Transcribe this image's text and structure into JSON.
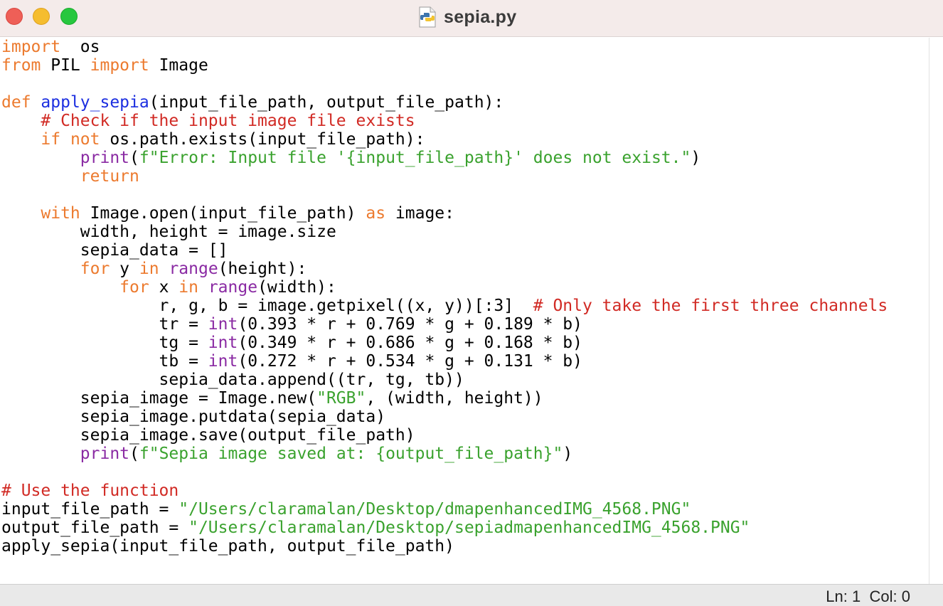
{
  "window": {
    "title": "sepia.py",
    "file_icon": "python-file-icon",
    "controls": [
      "close-button",
      "minimize-button",
      "zoom-button"
    ]
  },
  "status": {
    "ln_label": "Ln:",
    "ln_value": "1",
    "col_label": "Col:",
    "col_value": "0"
  },
  "colors": {
    "keyword": "#ec7a2e",
    "function_name": "#1b2ee0",
    "comment": "#d12a24",
    "string": "#3aa22e",
    "builtin": "#8a2aa3",
    "text": "#000000",
    "titlebar": "#f4ebea"
  },
  "code": {
    "lines": [
      [
        [
          "kw",
          "import"
        ],
        [
          "",
          "  os"
        ]
      ],
      [
        [
          "kw",
          "from"
        ],
        [
          "",
          " PIL "
        ],
        [
          "kw",
          "import"
        ],
        [
          "",
          " Image"
        ]
      ],
      [],
      [
        [
          "kw",
          "def"
        ],
        [
          "",
          " "
        ],
        [
          "fn",
          "apply_sepia"
        ],
        [
          "",
          "(input_file_path, output_file_path):"
        ]
      ],
      [
        [
          "",
          "    "
        ],
        [
          "cm",
          "# Check if the input image file exists"
        ]
      ],
      [
        [
          "",
          "    "
        ],
        [
          "kw",
          "if"
        ],
        [
          "",
          " "
        ],
        [
          "kw",
          "not"
        ],
        [
          "",
          " os.path.exists(input_file_path):"
        ]
      ],
      [
        [
          "",
          "        "
        ],
        [
          "bi",
          "print"
        ],
        [
          "",
          "("
        ],
        [
          "st",
          "f\"Error: Input file '{input_file_path}' does not exist.\""
        ],
        [
          "",
          ")"
        ]
      ],
      [
        [
          "",
          "        "
        ],
        [
          "kw",
          "return"
        ]
      ],
      [],
      [
        [
          "",
          "    "
        ],
        [
          "kw",
          "with"
        ],
        [
          "",
          " Image.open(input_file_path) "
        ],
        [
          "kw",
          "as"
        ],
        [
          "",
          " image:"
        ]
      ],
      [
        [
          "",
          "        width, height = image.size"
        ]
      ],
      [
        [
          "",
          "        sepia_data = []"
        ]
      ],
      [
        [
          "",
          "        "
        ],
        [
          "kw",
          "for"
        ],
        [
          "",
          " y "
        ],
        [
          "kw",
          "in"
        ],
        [
          "",
          " "
        ],
        [
          "bi",
          "range"
        ],
        [
          "",
          "(height):"
        ]
      ],
      [
        [
          "",
          "            "
        ],
        [
          "kw",
          "for"
        ],
        [
          "",
          " x "
        ],
        [
          "kw",
          "in"
        ],
        [
          "",
          " "
        ],
        [
          "bi",
          "range"
        ],
        [
          "",
          "(width):"
        ]
      ],
      [
        [
          "",
          "                r, g, b = image.getpixel((x, y))[:3]  "
        ],
        [
          "cm",
          "# Only take the first three channels"
        ]
      ],
      [
        [
          "",
          "                tr = "
        ],
        [
          "bi",
          "int"
        ],
        [
          "",
          "(0.393 * r + 0.769 * g + 0.189 * b)"
        ]
      ],
      [
        [
          "",
          "                tg = "
        ],
        [
          "bi",
          "int"
        ],
        [
          "",
          "(0.349 * r + 0.686 * g + 0.168 * b)"
        ]
      ],
      [
        [
          "",
          "                tb = "
        ],
        [
          "bi",
          "int"
        ],
        [
          "",
          "(0.272 * r + 0.534 * g + 0.131 * b)"
        ]
      ],
      [
        [
          "",
          "                sepia_data.append((tr, tg, tb))"
        ]
      ],
      [
        [
          "",
          "        sepia_image = Image.new("
        ],
        [
          "st",
          "\"RGB\""
        ],
        [
          "",
          ", (width, height))"
        ]
      ],
      [
        [
          "",
          "        sepia_image.putdata(sepia_data)"
        ]
      ],
      [
        [
          "",
          "        sepia_image.save(output_file_path)"
        ]
      ],
      [
        [
          "",
          "        "
        ],
        [
          "bi",
          "print"
        ],
        [
          "",
          "("
        ],
        [
          "st",
          "f\"Sepia image saved at: {output_file_path}\""
        ],
        [
          "",
          ")"
        ]
      ],
      [],
      [
        [
          "cm",
          "# Use the function"
        ]
      ],
      [
        [
          "",
          "input_file_path = "
        ],
        [
          "st",
          "\"/Users/claramalan/Desktop/dmapenhancedIMG_4568.PNG\""
        ]
      ],
      [
        [
          "",
          "output_file_path = "
        ],
        [
          "st",
          "\"/Users/claramalan/Desktop/sepiadmapenhancedIMG_4568.PNG\""
        ]
      ],
      [
        [
          "",
          "apply_sepia(input_file_path, output_file_path)"
        ]
      ]
    ]
  }
}
